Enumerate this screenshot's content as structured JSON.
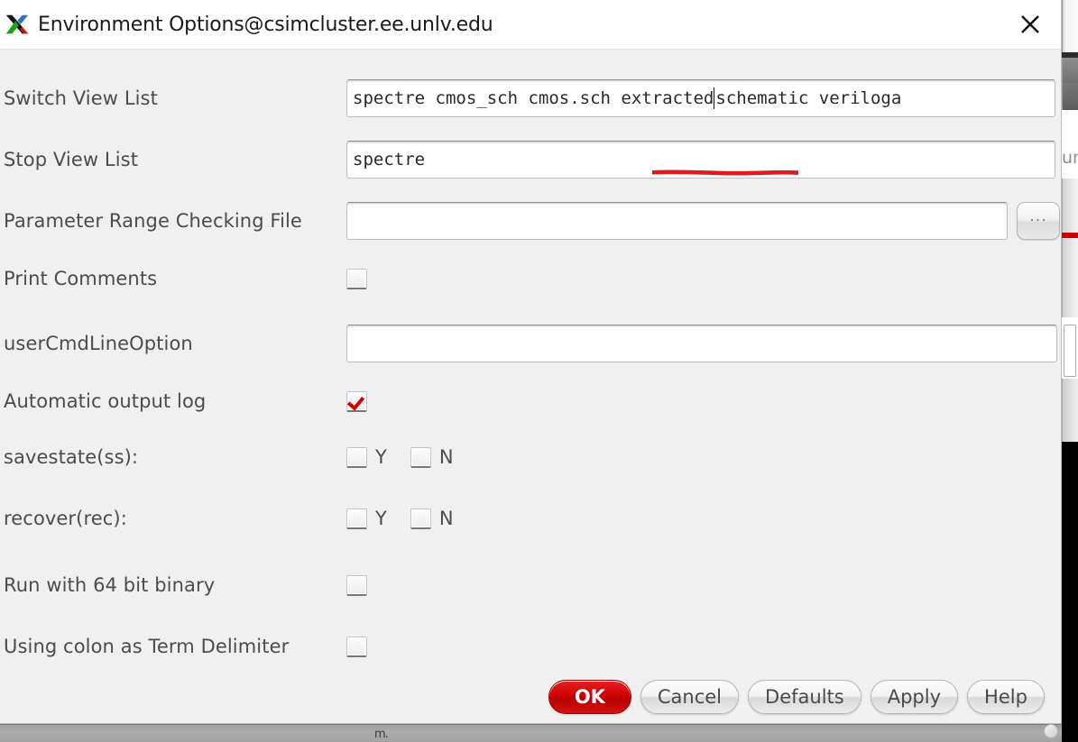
{
  "window": {
    "title": "Environment Options@csimcluster.ee.unlv.edu",
    "app_icon": "x-window-icon",
    "close_icon": "close-icon"
  },
  "form": {
    "switch_view_list": {
      "label": "Switch View List",
      "value_before_caret": "spectre cmos_sch cmos.sch extracted ",
      "value_after_caret": "schematic veriloga",
      "full_value": "spectre cmos_sch cmos.sch extracted schematic veriloga"
    },
    "stop_view_list": {
      "label": "Stop View List",
      "value": "spectre"
    },
    "parameter_range_checking_file": {
      "label": "Parameter Range Checking File",
      "value": "",
      "browse_label": "...",
      "browse_icon": "ellipsis-icon"
    },
    "print_comments": {
      "label": "Print Comments",
      "checked": false
    },
    "user_cmd_line_option": {
      "label": "userCmdLineOption",
      "value": ""
    },
    "automatic_output_log": {
      "label": "Automatic output log",
      "checked": true
    },
    "savestate": {
      "label": "savestate(ss):",
      "yes_label": "Y",
      "no_label": "N",
      "yes_checked": false,
      "no_checked": false
    },
    "recover": {
      "label": "recover(rec):",
      "yes_label": "Y",
      "no_label": "N",
      "yes_checked": false,
      "no_checked": false
    },
    "run_64_bit": {
      "label": "Run with 64 bit binary",
      "checked": false
    },
    "colon_term_delimiter": {
      "label": "Using colon as Term Delimiter",
      "checked": false
    }
  },
  "buttons": {
    "ok": "OK",
    "cancel": "Cancel",
    "defaults": "Defaults",
    "apply": "Apply",
    "help": "Help"
  },
  "annotation": {
    "underline_color": "#e01b1b",
    "underlines_text": "extracted"
  },
  "background": {
    "right_edge_text": "un",
    "bottom_partial_text": "m."
  },
  "colors": {
    "dialog_bg": "#f0f0f0",
    "titlebar_bg": "#ffffff",
    "label_text": "#4c4c4c",
    "field_bg": "#ffffff",
    "primary_button": "#cf0000",
    "checkmark": "#d00000",
    "annotation_red": "#e01b1b"
  }
}
